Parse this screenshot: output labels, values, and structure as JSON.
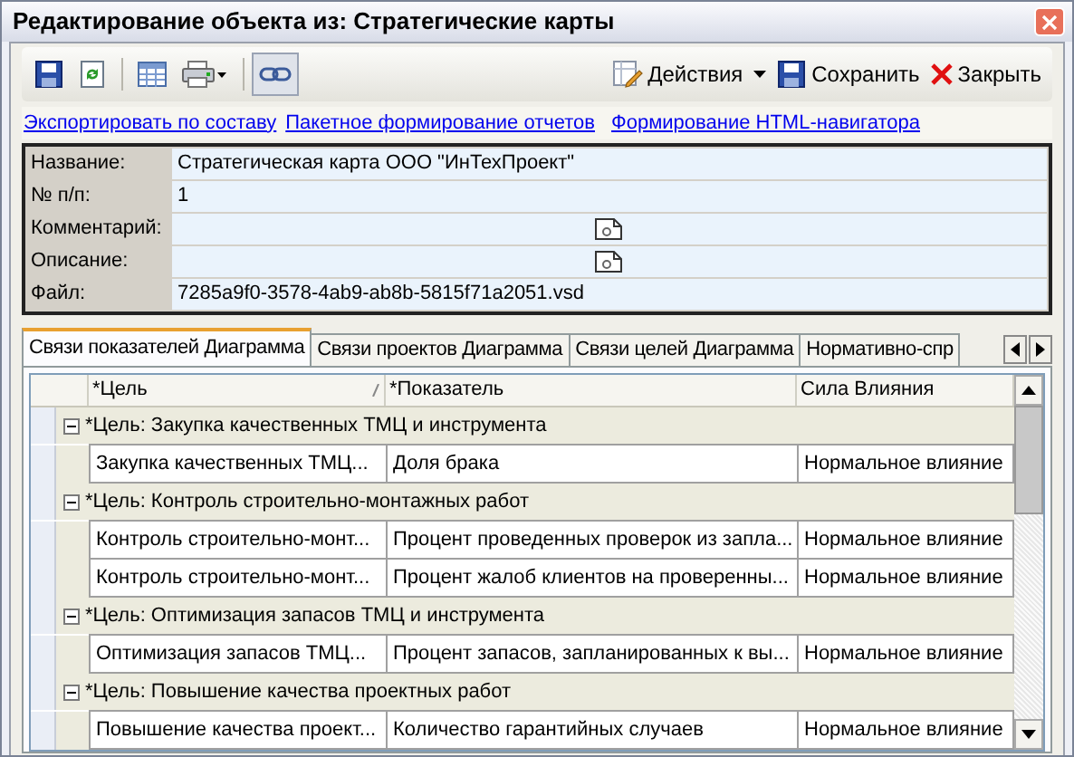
{
  "window": {
    "title": "Редактирование объекта из: Стратегические карты"
  },
  "toolbar": {
    "tools": [
      {
        "kind": "save",
        "pressed": false
      },
      {
        "kind": "refresh",
        "pressed": false
      },
      {
        "kind": "sep"
      },
      {
        "kind": "table",
        "pressed": false
      },
      {
        "kind": "print",
        "pressed": false
      },
      {
        "kind": "sep"
      },
      {
        "kind": "link",
        "pressed": true
      }
    ],
    "actions": [
      {
        "kind": "menu",
        "label": "Действия"
      },
      {
        "kind": "save",
        "label": "Сохранить"
      },
      {
        "kind": "close",
        "label": "Закрыть"
      }
    ]
  },
  "links": [
    "Экспортировать по составу",
    "Пакетное формирование отчетов",
    "Формирование HTML-навигатора"
  ],
  "form": [
    {
      "label": "Название:",
      "value": "Стратегическая карта ООО \"ИнТехПроект\"",
      "kind": "text"
    },
    {
      "label": "№ п/п:",
      "value": "1",
      "kind": "text"
    },
    {
      "label": "Комментарий:",
      "kind": "memo"
    },
    {
      "label": "Описание:",
      "kind": "memo"
    },
    {
      "label": "Файл:",
      "value": "7285a9f0-3578-4ab9-ab8b-5815f71a2051.vsd",
      "kind": "text"
    }
  ],
  "tabs": [
    {
      "label": "Связи показателей Диаграмма",
      "selected": true
    },
    {
      "label": "Связи проектов Диаграмма",
      "selected": false
    },
    {
      "label": "Связи целей Диаграмма",
      "selected": false
    },
    {
      "label": "Нормативно-спр",
      "selected": false
    }
  ],
  "table": {
    "columns": [
      "*Цель",
      "*Показатель",
      "Сила Влияния"
    ],
    "groups": [
      {
        "title": "*Цель: Закупка качественных ТМЦ и инструмента",
        "expanded": true,
        "rows": [
          [
            "Закупка качественных ТМЦ...",
            "Доля брака",
            "Нормальное влияние"
          ]
        ]
      },
      {
        "title": "*Цель: Контроль строительно-монтажных работ",
        "expanded": true,
        "rows": [
          [
            "Контроль  строительно-монт...",
            "Процент проведенных проверок из запла...",
            "Нормальное влияние"
          ],
          [
            "Контроль  строительно-монт...",
            "Процент жалоб клиентов на проверенны...",
            "Нормальное влияние"
          ]
        ]
      },
      {
        "title": "*Цель: Оптимизация запасов ТМЦ и инструмента",
        "expanded": true,
        "rows": [
          [
            "Оптимизация запасов ТМЦ...",
            "Процент запасов, запланированных к вы...",
            "Нормальное влияние"
          ]
        ]
      },
      {
        "title": "*Цель: Повышение качества проектных работ",
        "expanded": true,
        "rows": [
          [
            "Повышение качества проект...",
            "Количество гарантийных случаев",
            "Нормальное влияние"
          ]
        ]
      }
    ]
  }
}
